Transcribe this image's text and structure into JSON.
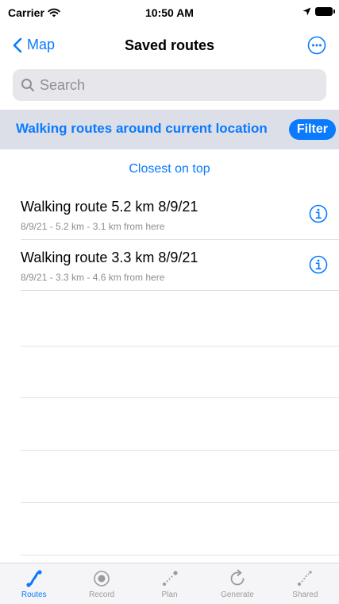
{
  "status_bar": {
    "carrier": "Carrier",
    "time": "10:50 AM"
  },
  "nav": {
    "back_label": "Map",
    "title": "Saved routes"
  },
  "search": {
    "placeholder": "Search"
  },
  "filter_bar": {
    "description": "Walking routes around current location",
    "filter_label": "Filter"
  },
  "sort": {
    "label": "Closest on top"
  },
  "routes": [
    {
      "title": "Walking route 5.2 km 8/9/21",
      "subtitle": "8/9/21 - 5.2 km - 3.1 km from here"
    },
    {
      "title": "Walking route 3.3 km 8/9/21",
      "subtitle": "8/9/21 - 3.3 km - 4.6 km from here"
    }
  ],
  "tab_bar": {
    "tabs": [
      {
        "label": "Routes",
        "icon": "route-icon",
        "active": true
      },
      {
        "label": "Record",
        "icon": "record-icon",
        "active": false
      },
      {
        "label": "Plan",
        "icon": "plan-icon",
        "active": false
      },
      {
        "label": "Generate",
        "icon": "generate-icon",
        "active": false
      },
      {
        "label": "Shared",
        "icon": "shared-icon",
        "active": false
      }
    ]
  },
  "colors": {
    "accent": "#0a7aff",
    "filter_bar_bg": "#dcdfe8",
    "inactive": "#9b9b9b"
  }
}
